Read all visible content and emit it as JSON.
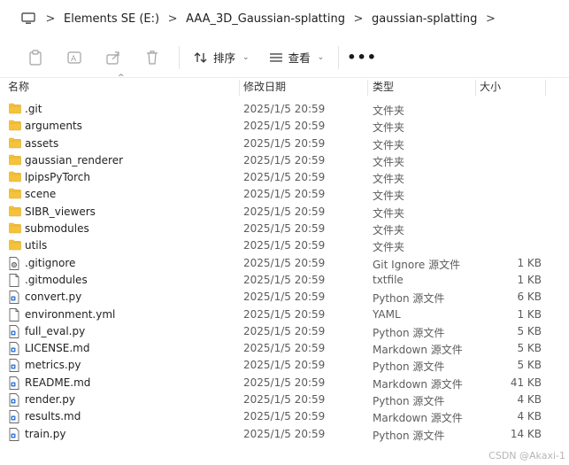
{
  "breadcrumb": [
    "Elements SE (E:)",
    "AAA_3D_Gaussian-splatting",
    "gaussian-splatting"
  ],
  "toolbar": {
    "sort_label": "排序",
    "view_label": "查看",
    "more_label": "•••"
  },
  "columns": {
    "name": "名称",
    "date": "修改日期",
    "type": "类型",
    "size": "大小"
  },
  "files": [
    {
      "name": ".git",
      "date": "2025/1/5 20:59",
      "type": "文件夹",
      "size": "",
      "icon": "folder-icon"
    },
    {
      "name": "arguments",
      "date": "2025/1/5 20:59",
      "type": "文件夹",
      "size": "",
      "icon": "folder-icon"
    },
    {
      "name": "assets",
      "date": "2025/1/5 20:59",
      "type": "文件夹",
      "size": "",
      "icon": "folder-icon"
    },
    {
      "name": "gaussian_renderer",
      "date": "2025/1/5 20:59",
      "type": "文件夹",
      "size": "",
      "icon": "folder-icon"
    },
    {
      "name": "lpipsPyTorch",
      "date": "2025/1/5 20:59",
      "type": "文件夹",
      "size": "",
      "icon": "folder-icon"
    },
    {
      "name": "scene",
      "date": "2025/1/5 20:59",
      "type": "文件夹",
      "size": "",
      "icon": "folder-icon"
    },
    {
      "name": "SIBR_viewers",
      "date": "2025/1/5 20:59",
      "type": "文件夹",
      "size": "",
      "icon": "folder-icon"
    },
    {
      "name": "submodules",
      "date": "2025/1/5 20:59",
      "type": "文件夹",
      "size": "",
      "icon": "folder-icon"
    },
    {
      "name": "utils",
      "date": "2025/1/5 20:59",
      "type": "文件夹",
      "size": "",
      "icon": "folder-icon"
    },
    {
      "name": ".gitignore",
      "date": "2025/1/5 20:59",
      "type": "Git Ignore 源文件",
      "size": "1 KB",
      "icon": "gear-file-icon"
    },
    {
      "name": ".gitmodules",
      "date": "2025/1/5 20:59",
      "type": "txtfile",
      "size": "1 KB",
      "icon": "file-icon"
    },
    {
      "name": "convert.py",
      "date": "2025/1/5 20:59",
      "type": "Python 源文件",
      "size": "6 KB",
      "icon": "code-file-icon"
    },
    {
      "name": "environment.yml",
      "date": "2025/1/5 20:59",
      "type": "YAML",
      "size": "1 KB",
      "icon": "file-icon"
    },
    {
      "name": "full_eval.py",
      "date": "2025/1/5 20:59",
      "type": "Python 源文件",
      "size": "5 KB",
      "icon": "code-file-icon"
    },
    {
      "name": "LICENSE.md",
      "date": "2025/1/5 20:59",
      "type": "Markdown 源文件",
      "size": "5 KB",
      "icon": "code-file-icon"
    },
    {
      "name": "metrics.py",
      "date": "2025/1/5 20:59",
      "type": "Python 源文件",
      "size": "5 KB",
      "icon": "code-file-icon"
    },
    {
      "name": "README.md",
      "date": "2025/1/5 20:59",
      "type": "Markdown 源文件",
      "size": "41 KB",
      "icon": "code-file-icon"
    },
    {
      "name": "render.py",
      "date": "2025/1/5 20:59",
      "type": "Python 源文件",
      "size": "4 KB",
      "icon": "code-file-icon"
    },
    {
      "name": "results.md",
      "date": "2025/1/5 20:59",
      "type": "Markdown 源文件",
      "size": "4 KB",
      "icon": "code-file-icon"
    },
    {
      "name": "train.py",
      "date": "2025/1/5 20:59",
      "type": "Python 源文件",
      "size": "14 KB",
      "icon": "code-file-icon"
    }
  ],
  "watermark": "CSDN @Akaxi-1",
  "colors": {
    "folder": "#f5c33b",
    "folder_dark": "#e0a82e",
    "code_accent": "#3a7bd5"
  }
}
